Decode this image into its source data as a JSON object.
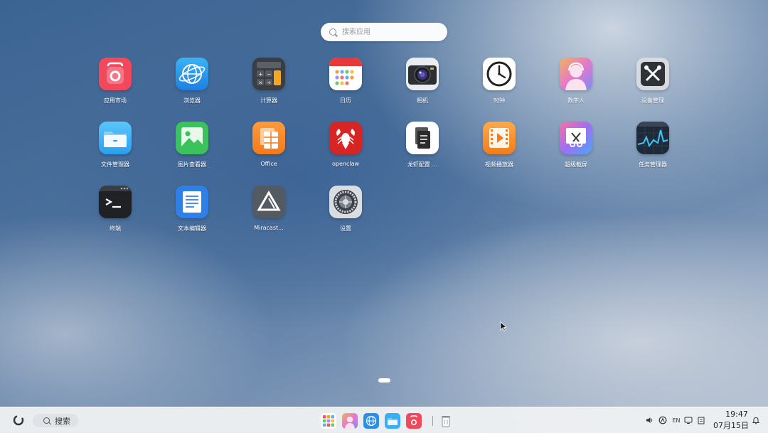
{
  "launcher": {
    "search_placeholder": "搜索应用",
    "apps": [
      {
        "label": "应用市场",
        "icon": "app-store-icon"
      },
      {
        "label": "浏览器",
        "icon": "browser-globe-icon"
      },
      {
        "label": "计算器",
        "icon": "calculator-icon"
      },
      {
        "label": "日历",
        "icon": "calendar-icon"
      },
      {
        "label": "相机",
        "icon": "camera-icon"
      },
      {
        "label": "时钟",
        "icon": "clock-icon"
      },
      {
        "label": "数字人",
        "icon": "digital-human-icon"
      },
      {
        "label": "设备管理",
        "icon": "device-manager-icon"
      },
      {
        "label": "文件管理器",
        "icon": "folder-icon"
      },
      {
        "label": "图片查看器",
        "icon": "image-viewer-icon"
      },
      {
        "label": "Office",
        "icon": "office-icon"
      },
      {
        "label": "openclaw",
        "icon": "lobster-icon"
      },
      {
        "label": "龙虾配置 ...",
        "icon": "document-config-icon"
      },
      {
        "label": "视频播放器",
        "icon": "video-player-icon"
      },
      {
        "label": "超级截屏",
        "icon": "screenshot-scissors-icon"
      },
      {
        "label": "任务管理器",
        "icon": "task-monitor-icon"
      },
      {
        "label": "终端",
        "icon": "terminal-icon"
      },
      {
        "label": "文本编辑器",
        "icon": "text-editor-icon"
      },
      {
        "label": "Miracast...",
        "icon": "miracast-triangle-icon"
      },
      {
        "label": "设置",
        "icon": "settings-gear-icon"
      }
    ]
  },
  "taskbar": {
    "search_label": "搜索",
    "tray": {
      "input_method": "EN"
    },
    "clock": {
      "time": "19:47",
      "date": "07月15日"
    }
  },
  "colors": {
    "taskbar_bg": "#eef0f3",
    "launcher_label": "#ffffff"
  }
}
